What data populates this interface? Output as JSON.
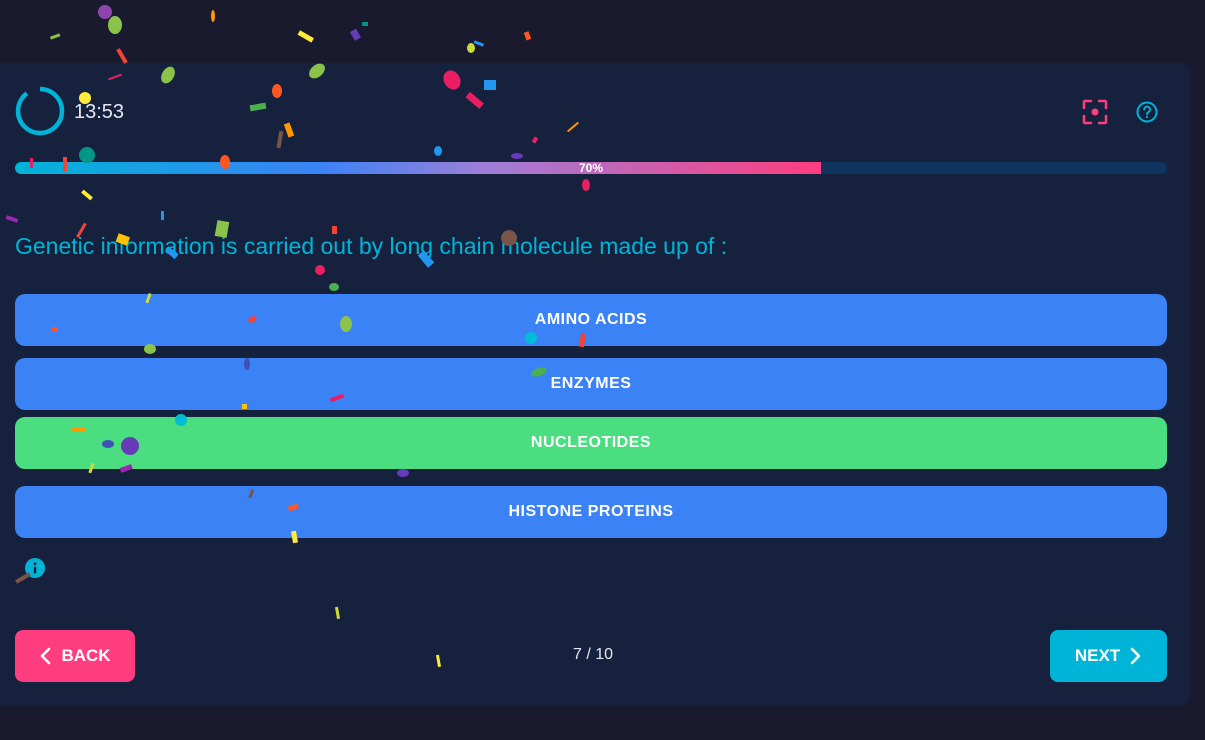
{
  "timer": {
    "remaining": "13:53"
  },
  "toolbar": {
    "focus_icon": "focus-target-icon",
    "help_icon": "help-circle-icon"
  },
  "progress": {
    "percent": 70,
    "label": "70%"
  },
  "question": {
    "text": "Genetic information is carried out by long chain molecule made up of :"
  },
  "options": [
    {
      "label": "AMINO ACIDS",
      "state": "default"
    },
    {
      "label": "ENZYMES",
      "state": "default"
    },
    {
      "label": "NUCLEOTIDES",
      "state": "correct"
    },
    {
      "label": "HISTONE PROTEINS",
      "state": "default"
    }
  ],
  "navigation": {
    "back_label": "BACK",
    "next_label": "NEXT",
    "counter": "7 / 10"
  },
  "colors": {
    "background": "#1a1a2e",
    "card": "#16213e",
    "accent_cyan": "#00b4d8",
    "accent_pink": "#ff3d7f",
    "option_blue": "#3b82f6",
    "correct_green": "#4ade80"
  }
}
